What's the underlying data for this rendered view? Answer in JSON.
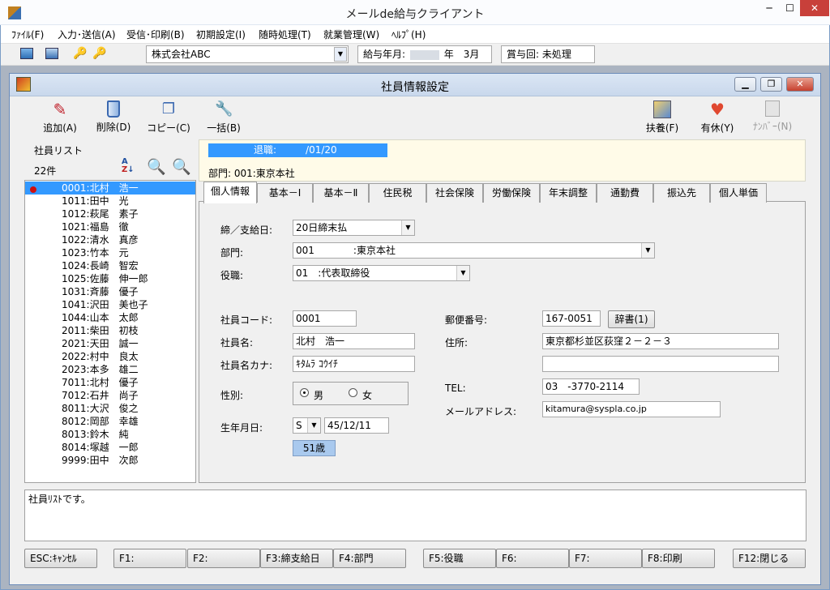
{
  "window": {
    "title": "メールde給与クライアント"
  },
  "menu": [
    "ﾌｧｲﾙ(F)",
    "入力･送信(A)",
    "受信･印刷(B)",
    "初期設定(I)",
    "随時処理(T)",
    "就業管理(W)",
    "ﾍﾙﾌﾟ(H)"
  ],
  "toolbar": {
    "company": "株式会社ABC",
    "pay_month_label": "給与年月:",
    "pay_month_value": "年　3月",
    "bonus": "賞与回: 未処理"
  },
  "form": {
    "title": "社員情報設定"
  },
  "tools": {
    "add": "追加(A)",
    "delete": "削除(D)",
    "copy": "コピー(C)",
    "bulk": "一括(B)",
    "dependents": "扶養(F)",
    "leave": "有休(Y)",
    "number": "ﾅﾝﾊﾞｰ(N)"
  },
  "list": {
    "header": "社員リスト",
    "count": "22件",
    "items": [
      "0001:北村　浩一",
      "1011:田中　光",
      "1012:萩尾　素子",
      "1021:福島　徹",
      "1022:清水　真彦",
      "1023:竹本　元",
      "1024:長崎　智宏",
      "1025:佐藤　伸一郎",
      "1031:斉藤　優子",
      "1041:沢田　美也子",
      "1044:山本　太郎",
      "2011:柴田　初枝",
      "2021:天田　誠一",
      "2022:村中　良太",
      "2023:本多　雄二",
      "7011:北村　優子",
      "7012:石井　尚子",
      "8011:大沢　俊之",
      "8012:岡部　幸雄",
      "8013:鈴木　純",
      "8014:塚越　一郎",
      "9999:田中　次郎"
    ]
  },
  "info": {
    "retired": "退職:　　　/01/20",
    "dept": "部門: 001:東京本社"
  },
  "tabs": [
    "個人情報",
    "基本－Ⅰ",
    "基本－Ⅱ",
    "住民税",
    "社会保険",
    "労働保険",
    "年末調整",
    "通勤費",
    "振込先",
    "個人単価"
  ],
  "fields": {
    "closing_label": "締／支給日:",
    "closing_value": "20日締末払",
    "dept_label": "部門:",
    "dept_value": "001　　　　:東京本社",
    "role_label": "役職:",
    "role_value": "01　:代表取締役",
    "code_label": "社員コード:",
    "code_value": "0001",
    "name_label": "社員名:",
    "name_value": "北村　浩一",
    "kana_label": "社員名カナ:",
    "kana_value": "ｷﾀﾑﾗ ｺｳｲﾁ",
    "gender_label": "性別:",
    "male": "男",
    "female": "女",
    "birth_label": "生年月日:",
    "era": "S",
    "birth_value": "45/12/11",
    "age": "51歳",
    "zip_label": "郵便番号:",
    "zip_value": "167-0051",
    "dict_button": "辞書(1)",
    "address_label": "住所:",
    "address_value": "東京都杉並区荻窪２－２－３",
    "address2_value": "",
    "tel_label": "TEL:",
    "tel_value": "03　-3770-2114",
    "mail_label": "メールアドレス:",
    "mail_value": "kitamura@syspla.co.jp"
  },
  "status": "社員ﾘｽﾄです。",
  "fkeys": [
    "ESC:ｷｬﾝｾﾙ",
    "F1:",
    "F2:",
    "F3:締支給日",
    "F4:部門",
    "F5:役職",
    "F6:",
    "F7:",
    "F8:印刷",
    "F12:閉じる"
  ]
}
